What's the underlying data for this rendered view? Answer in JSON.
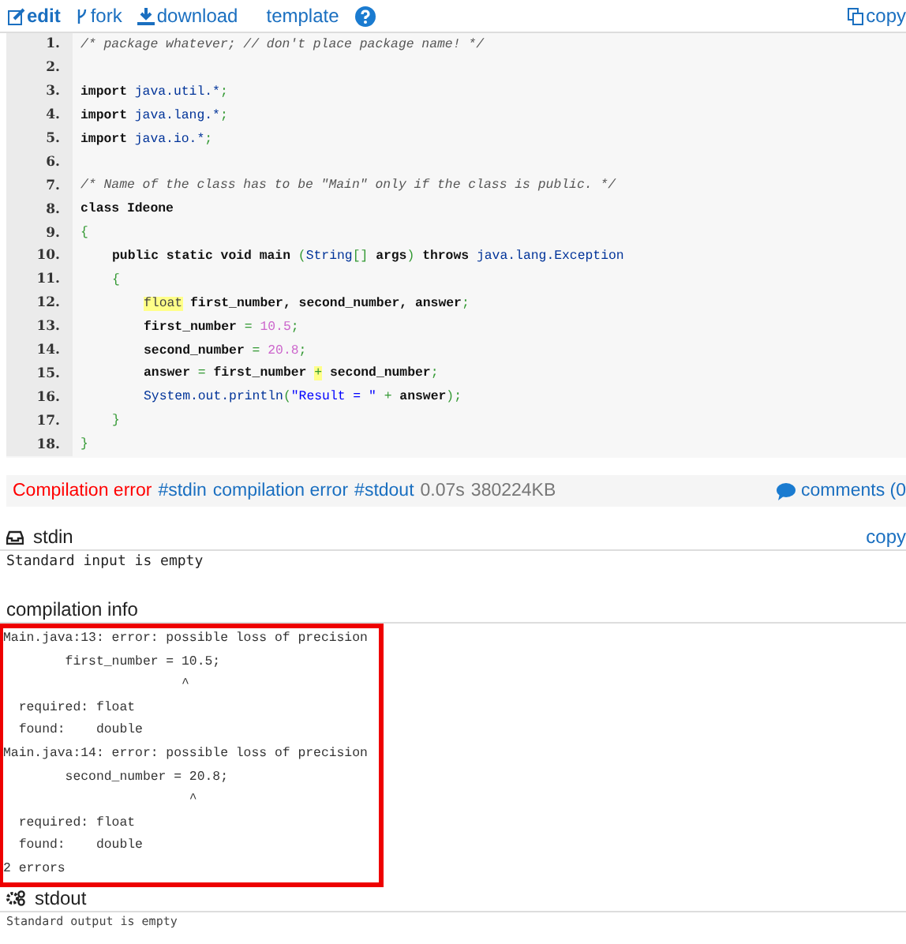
{
  "toolbar": {
    "links": [
      "edit",
      "fork",
      "download",
      "template"
    ],
    "copy": "copy"
  },
  "code": {
    "lines": [
      {
        "number": "1.",
        "segments": [
          {
            "t": "/* package whatever; // don't place package name! */",
            "kind": "comment",
            "marked": false
          }
        ]
      },
      {
        "number": "2."
      },
      {
        "number": "3.",
        "segments": [
          {
            "t": "import",
            "kind": "keyword",
            "marked": false
          },
          {
            "t": " java.util.*",
            "kind": "type",
            "marked": false
          },
          {
            "t": ";",
            "kind": "punct",
            "marked": false
          }
        ]
      },
      {
        "number": "4.",
        "segments": [
          {
            "t": "import",
            "kind": "keyword",
            "marked": false
          },
          {
            "t": " java.lang.*",
            "kind": "type",
            "marked": false
          },
          {
            "t": ";",
            "kind": "punct",
            "marked": false
          }
        ]
      },
      {
        "number": "5.",
        "segments": [
          {
            "t": "import",
            "kind": "keyword",
            "marked": false
          },
          {
            "t": " java.io.*",
            "kind": "type",
            "marked": false
          },
          {
            "t": ";",
            "kind": "punct",
            "marked": false
          }
        ]
      },
      {
        "number": "6."
      },
      {
        "number": "7.",
        "segments": [
          {
            "t": "/* Name of the class has to be \"Main\" only if the class is public. */",
            "kind": "comment",
            "marked": false
          }
        ]
      },
      {
        "number": "8.",
        "segments": [
          {
            "t": "class Ideone",
            "kind": "keyword",
            "marked": false
          }
        ]
      },
      {
        "number": "9.",
        "segments": [
          {
            "t": "{",
            "kind": "punct",
            "marked": false
          }
        ],
        "children": [
          {
            "number": "10.",
            "segments": [
              {
                "t": "public static void main ",
                "kind": "keyword",
                "marked": false
              },
              {
                "t": "(",
                "kind": "punct",
                "marked": false
              },
              {
                "t": "String",
                "kind": "type",
                "marked": false
              },
              {
                "t": "[]",
                "kind": "punct",
                "marked": false
              },
              {
                "t": " args",
                "kind": "keyword",
                "marked": false
              },
              {
                "t": ")",
                "kind": "punct",
                "marked": false
              },
              {
                "t": " throws ",
                "kind": "keyword",
                "marked": false
              },
              {
                "t": "java.lang.Exception",
                "kind": "type",
                "marked": false
              }
            ]
          },
          {
            "number": "11.",
            "segments": [
              {
                "t": "{",
                "kind": "punct",
                "marked": false
              }
            ],
            "children": [
              {
                "number": "12.",
                "segments": [
                  {
                    "t": "float",
                    "kind": "plain",
                    "marked": true
                  },
                  {
                    "t": " first_number, second_number, answer",
                    "kind": "keyword",
                    "marked": false
                  },
                  {
                    "t": ";",
                    "kind": "punct",
                    "marked": false
                  }
                ]
              },
              {
                "number": "13.",
                "segments": [
                  {
                    "t": "first_number ",
                    "kind": "keyword",
                    "marked": false
                  },
                  {
                    "t": "=",
                    "kind": "punct",
                    "marked": false
                  },
                  {
                    "t": " 10.5",
                    "kind": "number",
                    "marked": false
                  },
                  {
                    "t": ";",
                    "kind": "punct",
                    "marked": false
                  }
                ]
              },
              {
                "number": "14.",
                "segments": [
                  {
                    "t": "second_number ",
                    "kind": "keyword",
                    "marked": false
                  },
                  {
                    "t": "=",
                    "kind": "punct",
                    "marked": false
                  },
                  {
                    "t": " 20.8",
                    "kind": "number",
                    "marked": false
                  },
                  {
                    "t": ";",
                    "kind": "punct",
                    "marked": false
                  }
                ]
              },
              {
                "number": "15.",
                "segments": [
                  {
                    "t": "answer ",
                    "kind": "keyword",
                    "marked": false
                  },
                  {
                    "t": "=",
                    "kind": "punct",
                    "marked": false
                  },
                  {
                    "t": " first_number ",
                    "kind": "keyword",
                    "marked": false
                  },
                  {
                    "t": "+",
                    "kind": "punct",
                    "marked": true
                  },
                  {
                    "t": " second_number",
                    "kind": "keyword",
                    "marked": false
                  },
                  {
                    "t": ";",
                    "kind": "punct",
                    "marked": false
                  }
                ]
              },
              {
                "number": "16.",
                "segments": [
                  {
                    "t": "System.out.println",
                    "kind": "type",
                    "marked": false
                  },
                  {
                    "t": "(",
                    "kind": "punct",
                    "marked": false
                  },
                  {
                    "t": "\"Result = \"",
                    "kind": "string",
                    "marked": false
                  },
                  {
                    "t": " + ",
                    "kind": "punct",
                    "marked": false
                  },
                  {
                    "t": "answer",
                    "kind": "keyword",
                    "marked": false
                  },
                  {
                    "t": ");",
                    "kind": "punct",
                    "marked": false
                  }
                ]
              }
            ]
          },
          {
            "number": "17.",
            "segments": [
              {
                "t": "}",
                "kind": "punct",
                "marked": false
              }
            ]
          }
        ]
      },
      {
        "number": "18.",
        "segments": [
          {
            "t": "}",
            "kind": "punct",
            "marked": false
          }
        ]
      }
    ]
  },
  "status_bar": {
    "result": "Compilation error",
    "links": [
      "#stdin",
      "compilation error",
      "#stdout"
    ],
    "time": "0.07s",
    "memory": "380224KB",
    "comments": "comments (0"
  },
  "stdin": {
    "title": "stdin",
    "copy": "copy",
    "text": "Standard input is empty"
  },
  "compilation_info": {
    "title": "compilation info",
    "output": "Main.java:13: error: possible loss of precision\n        first_number = 10.5;\n                       ^\n  required: float\n  found:    double\nMain.java:14: error: possible loss of precision\n        second_number = 20.8;\n                        ^\n  required: float\n  found:    double\n2 errors"
  },
  "stdout": {
    "title": "stdout",
    "text": "Standard output is empty"
  }
}
